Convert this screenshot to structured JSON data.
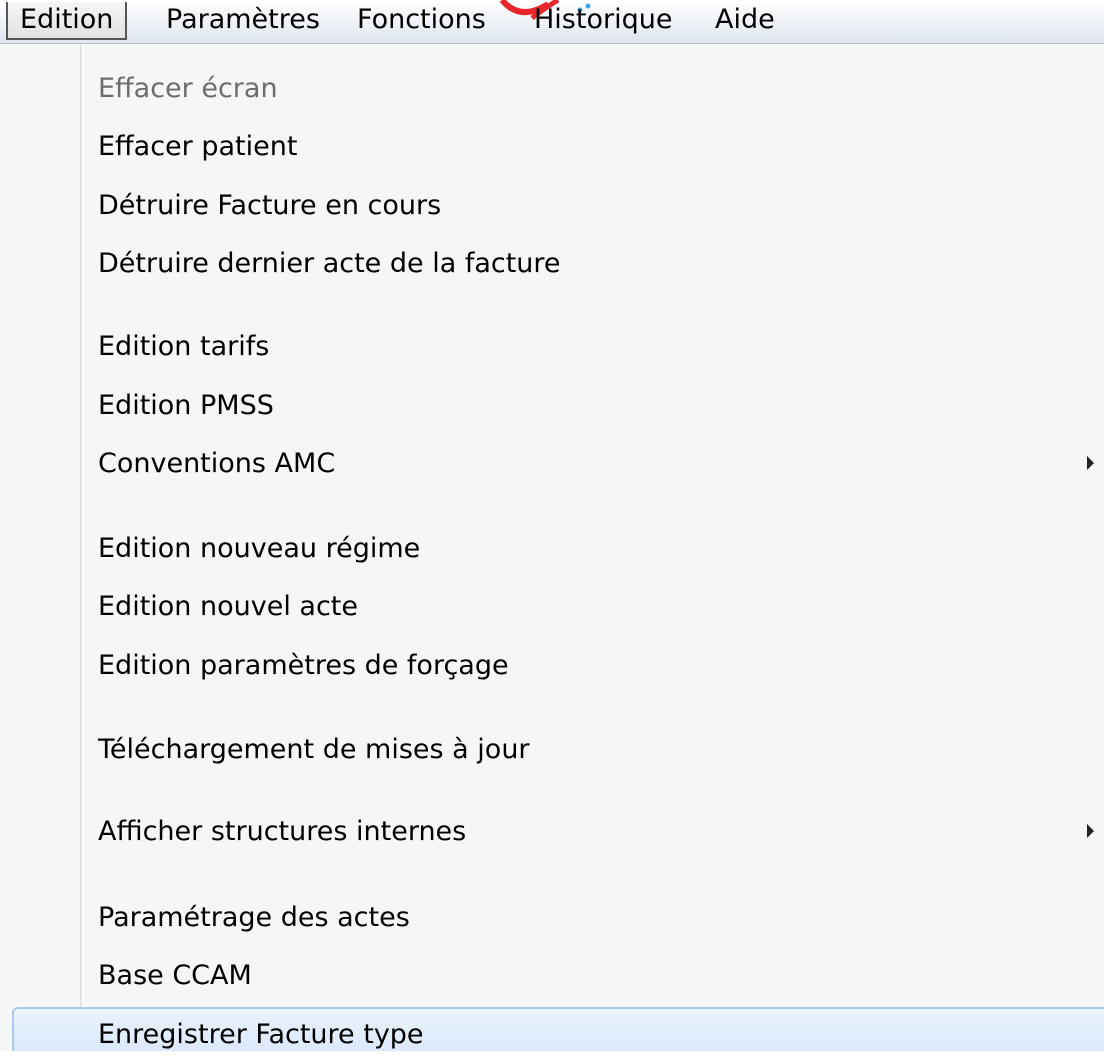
{
  "menubar": {
    "items": [
      "Edition",
      "Paramètres",
      "Fonctions",
      "Historique",
      "Aide"
    ],
    "active": "Edition"
  },
  "dropdown": {
    "items": [
      {
        "label": "Effacer écran",
        "disabled": true
      },
      {
        "label": "Effacer patient"
      },
      {
        "label": "Détruire Facture en cours"
      },
      {
        "label": "Détruire dernier acte de la facture"
      },
      {
        "label": "Edition tarifs"
      },
      {
        "label": "Edition PMSS"
      },
      {
        "label": "Conventions AMC",
        "submenu": true,
        "arrow_icon": "chevron-right-icon"
      },
      {
        "label": "Edition nouveau régime"
      },
      {
        "label": "Edition nouvel acte"
      },
      {
        "label": "Edition paramètres de forçage"
      },
      {
        "label": "Téléchargement de mises à jour"
      },
      {
        "label": "Afficher structures internes",
        "submenu": true,
        "arrow_icon": "chevron-right-icon"
      },
      {
        "label": "Paramétrage des actes"
      },
      {
        "label": "Base CCAM"
      },
      {
        "label": "Enregistrer Facture type",
        "highlighted": true
      }
    ]
  },
  "colors": {
    "highlight_bg": "#dbe9fb",
    "highlight_border": "#a9c9ef",
    "disabled_text": "#6d6d6d",
    "logo_red": "#e8262b",
    "logo_blue": "#3aa5e0"
  }
}
